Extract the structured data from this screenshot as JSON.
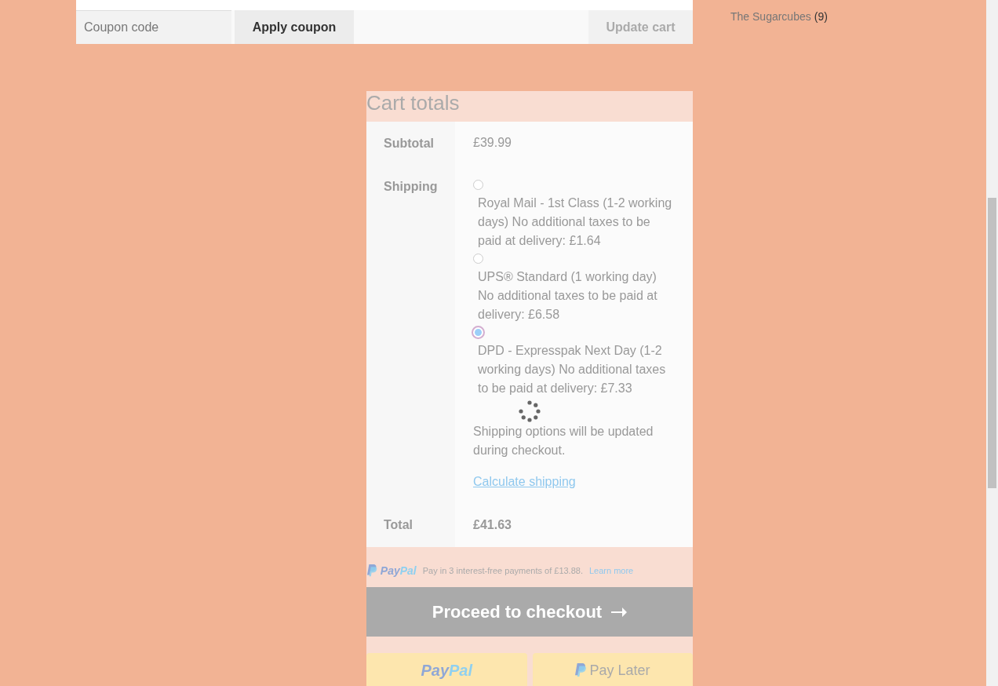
{
  "coupon": {
    "placeholder": "Coupon code",
    "apply_label": "Apply coupon",
    "update_label": "Update cart"
  },
  "sidebar": {
    "items": [
      {
        "label": "The Sugarcubes",
        "count": "(9)"
      }
    ]
  },
  "cart_totals": {
    "title": "Cart totals",
    "subtotal_label": "Subtotal",
    "subtotal": "£39.99",
    "shipping_label": "Shipping",
    "shipping_options": [
      {
        "label": "Royal Mail - 1st Class (1-2 working days) No additional taxes to be paid at delivery: £1.64",
        "selected": false
      },
      {
        "label": "UPS® Standard (1 working day) No additional taxes to be paid at delivery: £6.58",
        "selected": false
      },
      {
        "label": "DPD - Expresspak Next Day (1-2 working days) No additional taxes to be paid at delivery: £7.33",
        "selected": true
      }
    ],
    "shipping_note": "Shipping options will be updated during checkout.",
    "calculate_link": "Calculate shipping",
    "total_label": "Total",
    "total": "£41.63",
    "loading": true
  },
  "paypal_message": {
    "logo_parts": [
      "Pay",
      "Pal"
    ],
    "text": "Pay in 3 interest-free payments of £13.88.",
    "link": "Learn more"
  },
  "checkout_button": "Proceed to checkout",
  "paypal_buttons": [
    {
      "kind": "paypal",
      "parts": [
        "Pay",
        "Pal"
      ]
    },
    {
      "kind": "paylater",
      "label": "Pay Later"
    }
  ]
}
